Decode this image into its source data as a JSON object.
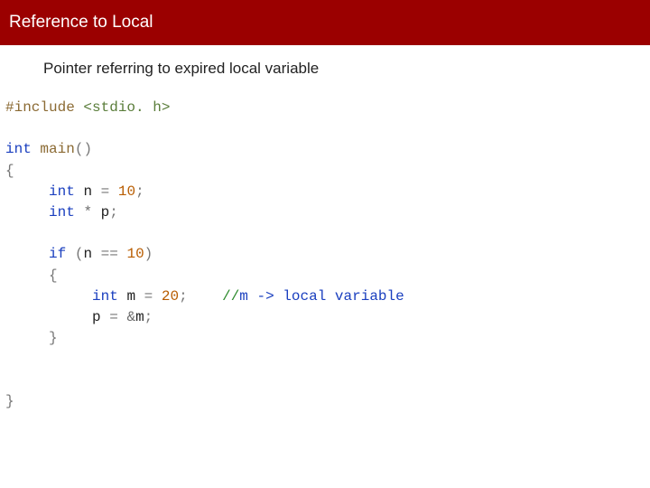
{
  "header": {
    "title": "Reference to Local"
  },
  "subtitle": "Pointer referring to expired local variable",
  "code": {
    "include_kw": "#include",
    "include_hdr": "<stdio. h>",
    "int": "int",
    "main": "main",
    "lp": "(",
    "rp": ")",
    "lb": "{",
    "rb": "}",
    "n": "n",
    "m": "m",
    "p": "p",
    "eq": "=",
    "eqeq": "==",
    "star": "*",
    "amp": "&",
    "semi": ";",
    "if": "if",
    "ten": "10",
    "twenty": "20",
    "comment_slash": "//",
    "comment_text": "m -> local variable"
  }
}
